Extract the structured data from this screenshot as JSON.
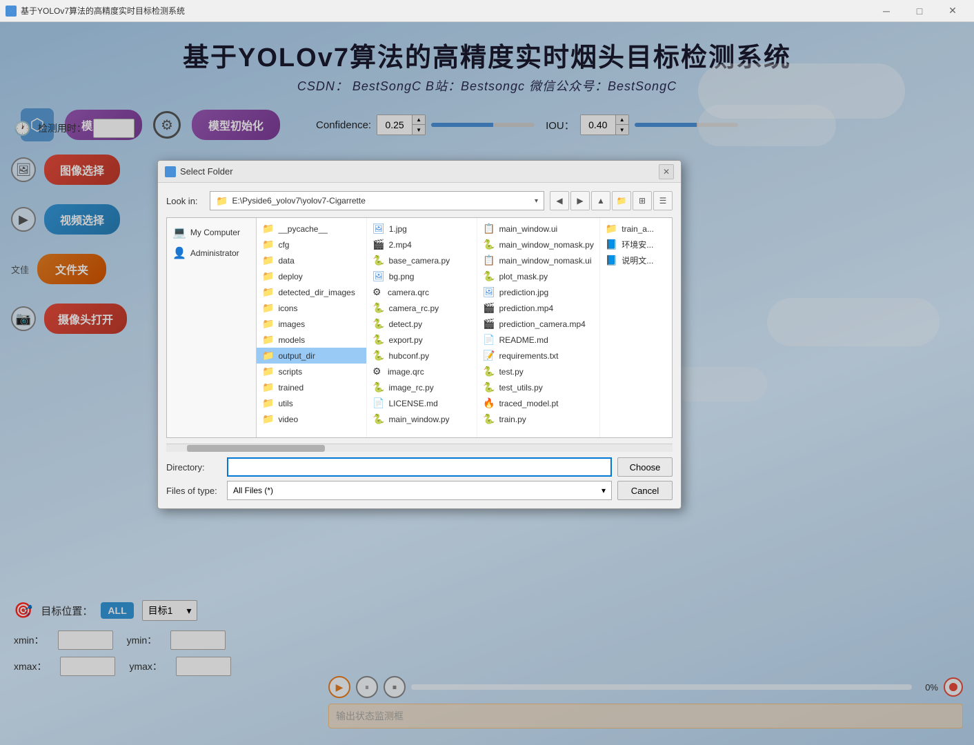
{
  "titlebar": {
    "title": "基于YOLOv7算法的高精度实时目标检测系统",
    "min_btn": "─",
    "max_btn": "□",
    "close_btn": "✕"
  },
  "header": {
    "main_title": "基于YOLOv7算法的高精度实时烟头目标检测系统",
    "subtitle": "CSDN： BestSongC   B站：Bestsongc   微信公众号：BestSongC"
  },
  "toolbar": {
    "model_select_label": "模型选择",
    "model_init_label": "模型初始化",
    "confidence_label": "Confidence:",
    "confidence_value": "0.25",
    "iou_label": "IOU：",
    "iou_value": "0.40"
  },
  "sidebar": {
    "detect_time_label": "检测用时：",
    "image_select_label": "图像选择",
    "video_select_label": "视频选择",
    "folder_label": "文件夹",
    "folder_owner": "文佳",
    "camera_label": "摄像头打开"
  },
  "bottom_left": {
    "target_position_label": "目标位置：",
    "all_btn_label": "ALL",
    "target_dropdown_label": "目标1",
    "xmin_label": "xmin：",
    "xmin_value": "",
    "ymin_label": "ymin：",
    "ymin_value": "",
    "xmax_label": "xmax：",
    "xmax_value": "",
    "ymax_label": "ymax：",
    "ymax_value": ""
  },
  "bottom_right": {
    "progress_pct": "0%",
    "status_placeholder": "输出状态监测框"
  },
  "dialog": {
    "title": "Select Folder",
    "lookin_label": "Look in:",
    "lookin_path": "E:\\Pyside6_yolov7\\yolov7-Cigarrette",
    "directory_label": "Directory:",
    "directory_value": "",
    "filetype_label": "Files of type:",
    "filetype_value": "All Files (*)",
    "choose_btn": "Choose",
    "cancel_btn": "Cancel",
    "tree": [
      {
        "label": "My Computer",
        "icon": "💻"
      },
      {
        "label": "Administrator",
        "icon": "👤"
      }
    ],
    "files_col1": [
      {
        "label": "__pycache__",
        "type": "folder"
      },
      {
        "label": "cfg",
        "type": "folder"
      },
      {
        "label": "data",
        "type": "folder"
      },
      {
        "label": "deploy",
        "type": "folder"
      },
      {
        "label": "detected_dir_images",
        "type": "folder"
      },
      {
        "label": "icons",
        "type": "folder"
      },
      {
        "label": "images",
        "type": "folder"
      },
      {
        "label": "models",
        "type": "folder"
      },
      {
        "label": "output_dir",
        "type": "folder",
        "selected": true
      },
      {
        "label": "scripts",
        "type": "folder"
      },
      {
        "label": "trained",
        "type": "folder"
      },
      {
        "label": "utils",
        "type": "folder"
      },
      {
        "label": "video",
        "type": "folder"
      }
    ],
    "files_col2": [
      {
        "label": "1.jpg",
        "type": "img"
      },
      {
        "label": "2.mp4",
        "type": "video"
      },
      {
        "label": "base_camera.py",
        "type": "py"
      },
      {
        "label": "bg.png",
        "type": "img"
      },
      {
        "label": "camera.qrc",
        "type": "qrc"
      },
      {
        "label": "camera_rc.py",
        "type": "py"
      },
      {
        "label": "detect.py",
        "type": "py"
      },
      {
        "label": "export.py",
        "type": "py"
      },
      {
        "label": "hubconf.py",
        "type": "py"
      },
      {
        "label": "image.qrc",
        "type": "qrc"
      },
      {
        "label": "image_rc.py",
        "type": "py"
      },
      {
        "label": "LICENSE.md",
        "type": "md"
      },
      {
        "label": "main_window.py",
        "type": "py"
      }
    ],
    "files_col3": [
      {
        "label": "main_window.ui",
        "type": "ui"
      },
      {
        "label": "main_window_nomask.py",
        "type": "py"
      },
      {
        "label": "main_window_nomask.ui",
        "type": "ui"
      },
      {
        "label": "plot_mask.py",
        "type": "py"
      },
      {
        "label": "prediction.jpg",
        "type": "img"
      },
      {
        "label": "prediction.mp4",
        "type": "video"
      },
      {
        "label": "prediction_camera.mp4",
        "type": "video"
      },
      {
        "label": "README.md",
        "type": "md"
      },
      {
        "label": "requirements.txt",
        "type": "txt"
      },
      {
        "label": "test.py",
        "type": "py"
      },
      {
        "label": "test_utils.py",
        "type": "py"
      },
      {
        "label": "traced_model.pt",
        "type": "pt"
      },
      {
        "label": "train.py",
        "type": "py"
      }
    ],
    "files_col4": [
      {
        "label": "train_a...",
        "type": "folder"
      },
      {
        "label": "环境安...",
        "type": "doc"
      },
      {
        "label": "说明文...",
        "type": "doc"
      }
    ]
  }
}
